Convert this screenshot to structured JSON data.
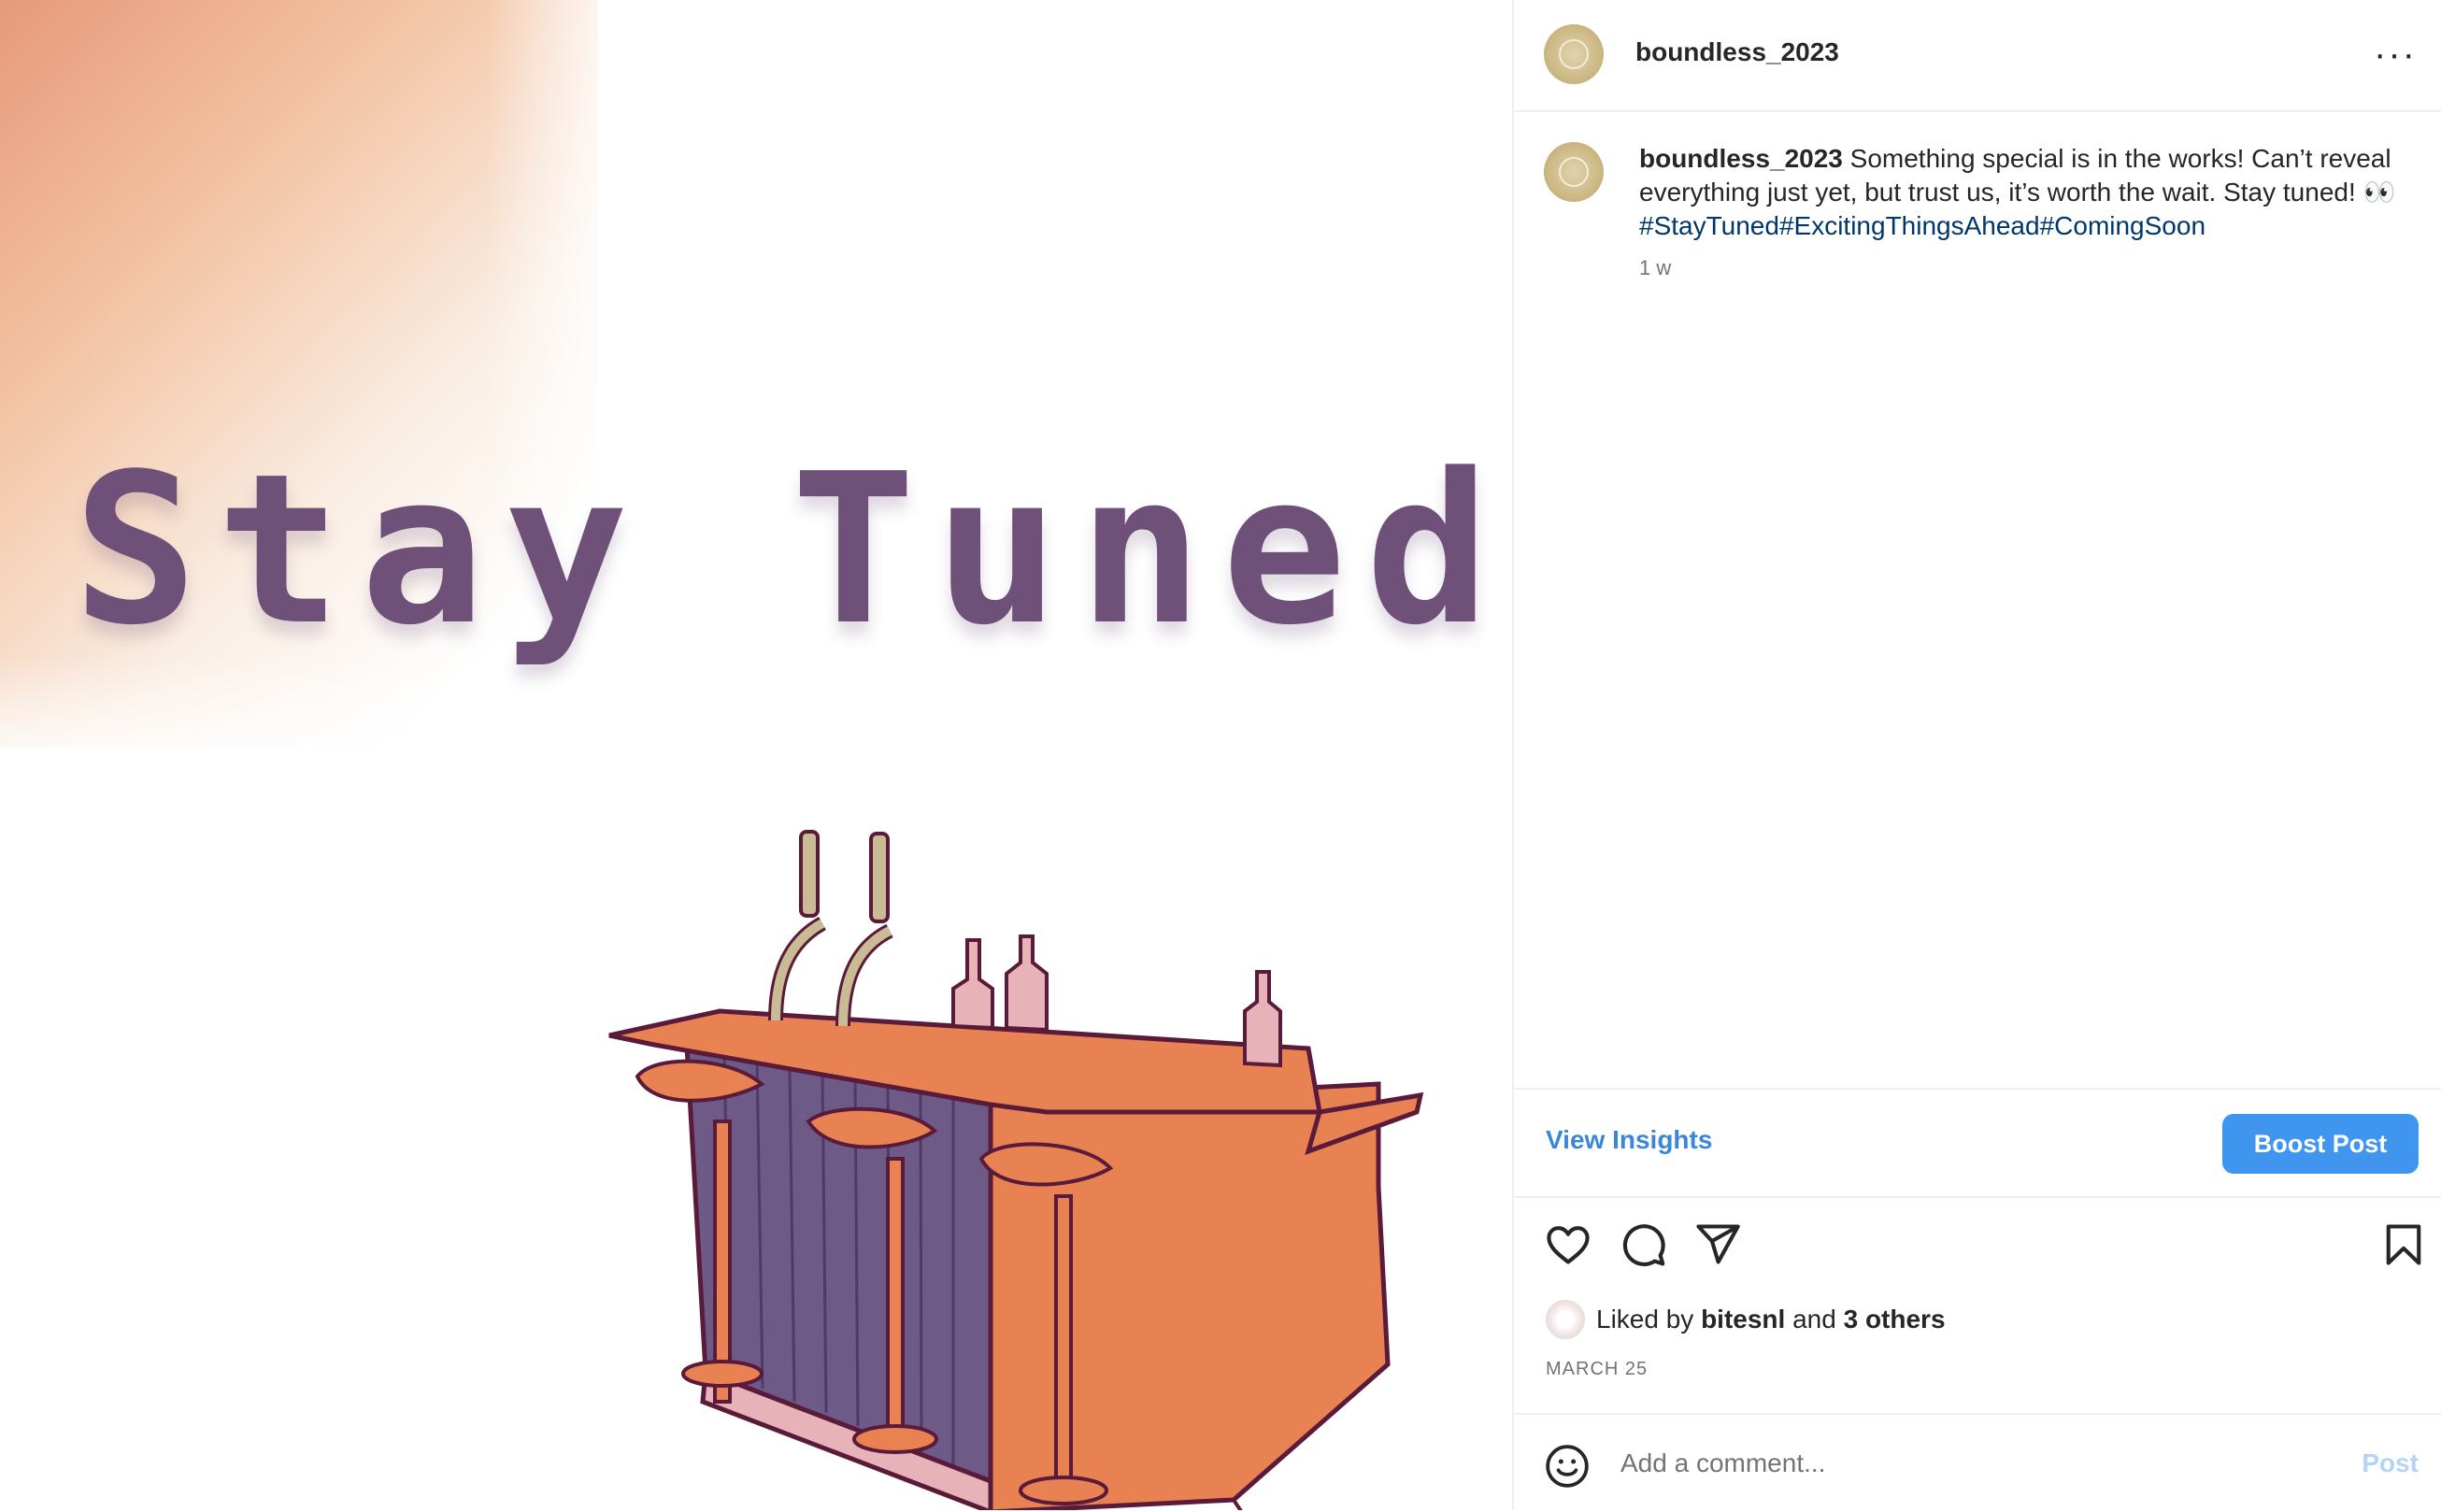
{
  "post": {
    "image": {
      "headline": "Stay Tuned...",
      "illustration_icon": "bar-counter-illustration"
    },
    "header": {
      "username": "boundless_2023",
      "more_icon": "more-horizontal-icon",
      "more_label": "···"
    },
    "caption": {
      "username": "boundless_2023",
      "text": "Something special is in the works! Can’t reveal everything just yet, but trust us, it’s worth the wait. Stay tuned! 👀",
      "hashtags": [
        "#StayTuned",
        "#ExcitingThingsAhead",
        "#ComingSoon"
      ],
      "time_ago": "1 w"
    },
    "insights": {
      "view_label": "View Insights",
      "boost_label": "Boost Post"
    },
    "actions": {
      "like_icon": "heart-icon",
      "comment_icon": "comment-icon",
      "share_icon": "share-icon",
      "save_icon": "bookmark-icon"
    },
    "likes": {
      "prefix": "Liked by",
      "liker": "bitesnl",
      "joiner": "and",
      "others": "3 others"
    },
    "date": "MARCH 25",
    "comment": {
      "emoji_icon": "emoji-icon",
      "placeholder": "Add a comment...",
      "post_label": "Post"
    },
    "colors": {
      "headline": "#6e5079",
      "accent_blue": "#4096ef",
      "link_blue": "#3a86d9",
      "hashtag": "#00376b",
      "bar_orange": "#e88252",
      "bar_purple": "#6d5a86"
    }
  }
}
